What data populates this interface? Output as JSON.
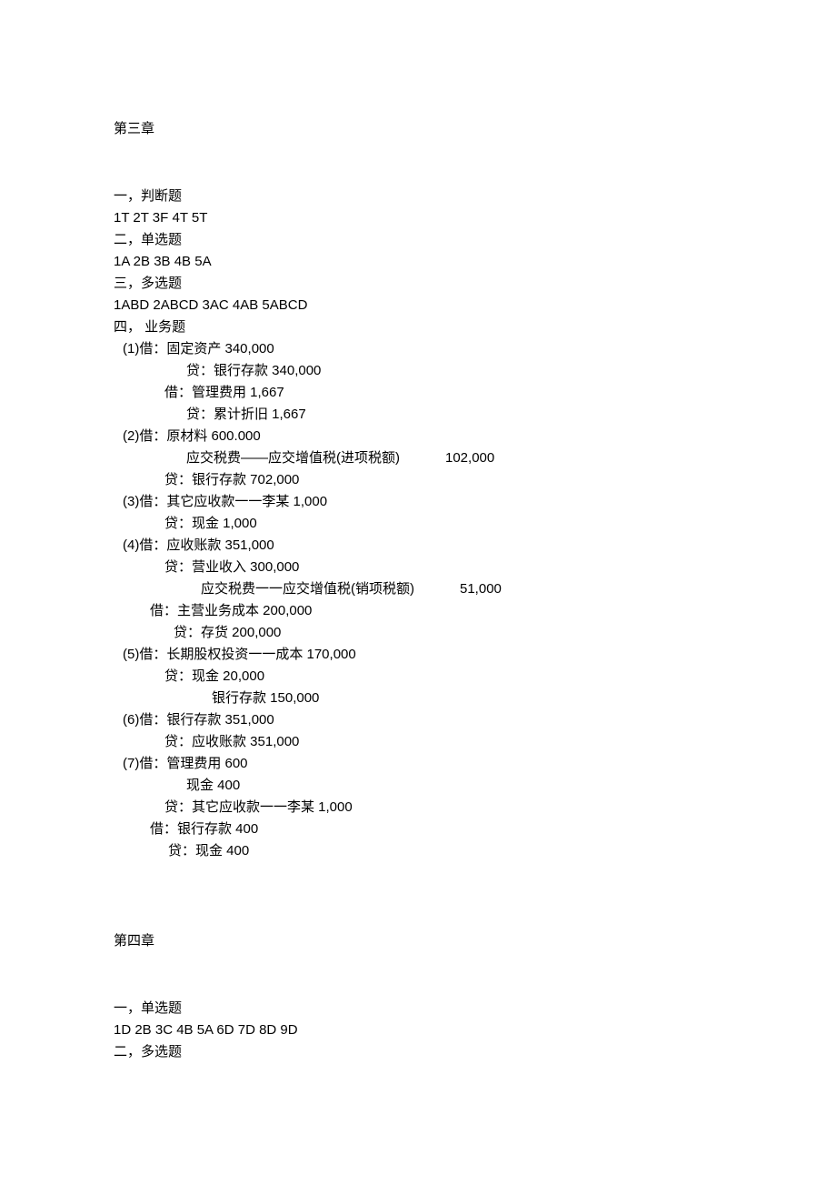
{
  "chapter3": {
    "title": "第三章",
    "sec1_label": "一，判断题",
    "sec1_answers": "1T 2T 3F 4T 5T",
    "sec2_label": "二，单选题",
    "sec2_answers": "1A 2B 3B 4B 5A",
    "sec3_label": "三，多选题",
    "sec3_answers": "1ABD 2ABCD 3AC 4AB 5ABCD",
    "sec4_label": "四，  业务题",
    "entries": {
      "e1_l1": "(1)借：固定资产  340,000",
      "e1_l2": "贷：银行存款 340,000",
      "e1_l3": "借：管理费用 1,667",
      "e1_l4": "贷：累计折旧 1,667",
      "e2_l1": "(2)借：原材料  600.000",
      "e2_l2": "应交税费——应交增值税(进项税额)",
      "e2_l2_amt": "102,000",
      "e2_l3": "贷：银行存款 702,000",
      "e3_l1": "(3)借：其它应收款一一李某 1,000",
      "e3_l2": "贷：现金 1,000",
      "e4_l1": "(4)借：应收账款  351,000",
      "e4_l2": "贷：营业收入 300,000",
      "e4_l3": "应交税费一一应交增值税(销项税额)",
      "e4_l3_amt": "51,000",
      "e4_l4": "借：主营业务成本  200,000",
      "e4_l5": "贷：存货 200,000",
      "e5_l1": "(5)借：长期股权投资一一成本 170,000",
      "e5_l2": "贷：现金 20,000",
      "e5_l3": "银行存款 150,000",
      "e6_l1": "(6)借：银行存款  351,000",
      "e6_l2": "贷：应收账款 351,000",
      "e7_l1": "(7)借：管理费用 600",
      "e7_l2": "现金 400",
      "e7_l3": "贷：其它应收款一一李某 1,000",
      "e7_l4": "借：银行存款 400",
      "e7_l5": "贷：现金 400"
    }
  },
  "chapter4": {
    "title": "第四章",
    "sec1_label": "一，单选题",
    "sec1_answers": "1D 2B 3C 4B 5A 6D 7D 8D 9D",
    "sec2_label": "二，多选题"
  }
}
